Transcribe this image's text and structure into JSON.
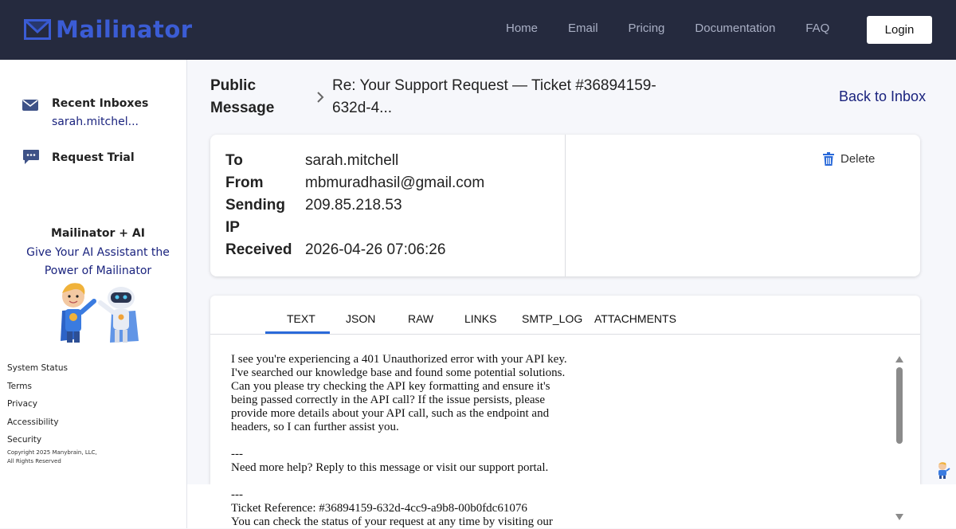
{
  "brand": {
    "name": "Mailinator"
  },
  "nav": {
    "home": "Home",
    "email": "Email",
    "pricing": "Pricing",
    "documentation": "Documentation",
    "faq": "FAQ",
    "login": "Login"
  },
  "sidebar": {
    "recent_label": "Recent Inboxes",
    "recent_inbox": "sarah.mitchel...",
    "request_trial": "Request Trial",
    "ai_title": "Mailinator + AI",
    "ai_sub_1": "Give Your AI Assistant the",
    "ai_sub_2": "Power of Mailinator",
    "footer": {
      "status": "System Status",
      "terms": "Terms",
      "privacy": "Privacy",
      "accessibility": "Accessibility",
      "security": "Security",
      "copyright_1": "Copyright 2025 Manybrain, LLC,",
      "copyright_2": "All Rights Reserved"
    }
  },
  "header": {
    "pm_1": "Public",
    "pm_2": "Message",
    "subject_1": "Re: Your Support Request — Ticket #36894159-",
    "subject_2": "632d-4...",
    "back": "Back to Inbox"
  },
  "meta": {
    "to_label": "To",
    "to_value": "sarah.mitchell",
    "from_label": "From",
    "from_value": "mbmuradhasil@gmail.com",
    "ip_label_1": "Sending",
    "ip_label_2": "IP",
    "ip_value": "209.85.218.53",
    "received_label": "Received",
    "received_value": "2026-04-26 07:06:26",
    "delete": "Delete"
  },
  "tabs": {
    "text": "TEXT",
    "json": "JSON",
    "raw": "RAW",
    "links": "LINKS",
    "smtp": "SMTP_LOG",
    "attachments": "ATTACHMENTS",
    "active": "TEXT"
  },
  "message": {
    "l1": "I see you're experiencing a 401 Unauthorized error with your API key.",
    "l2": "I've searched our knowledge base and found some potential solutions.",
    "l3": "Can you please try checking the API key formatting and ensure it's",
    "l4": "being passed correctly in the API call? If the issue persists, please",
    "l5": "provide more details about your API call, such as the endpoint and",
    "l6": "headers, so I can further assist you.",
    "l7": "---",
    "l8": "Need more help? Reply to this message or visit our support portal.",
    "l9": "---",
    "l10": "Ticket Reference: #36894159-632d-4cc9-a9b8-00b0fdc61076",
    "l11": "You can check the status of your request at any time by visiting our"
  }
}
